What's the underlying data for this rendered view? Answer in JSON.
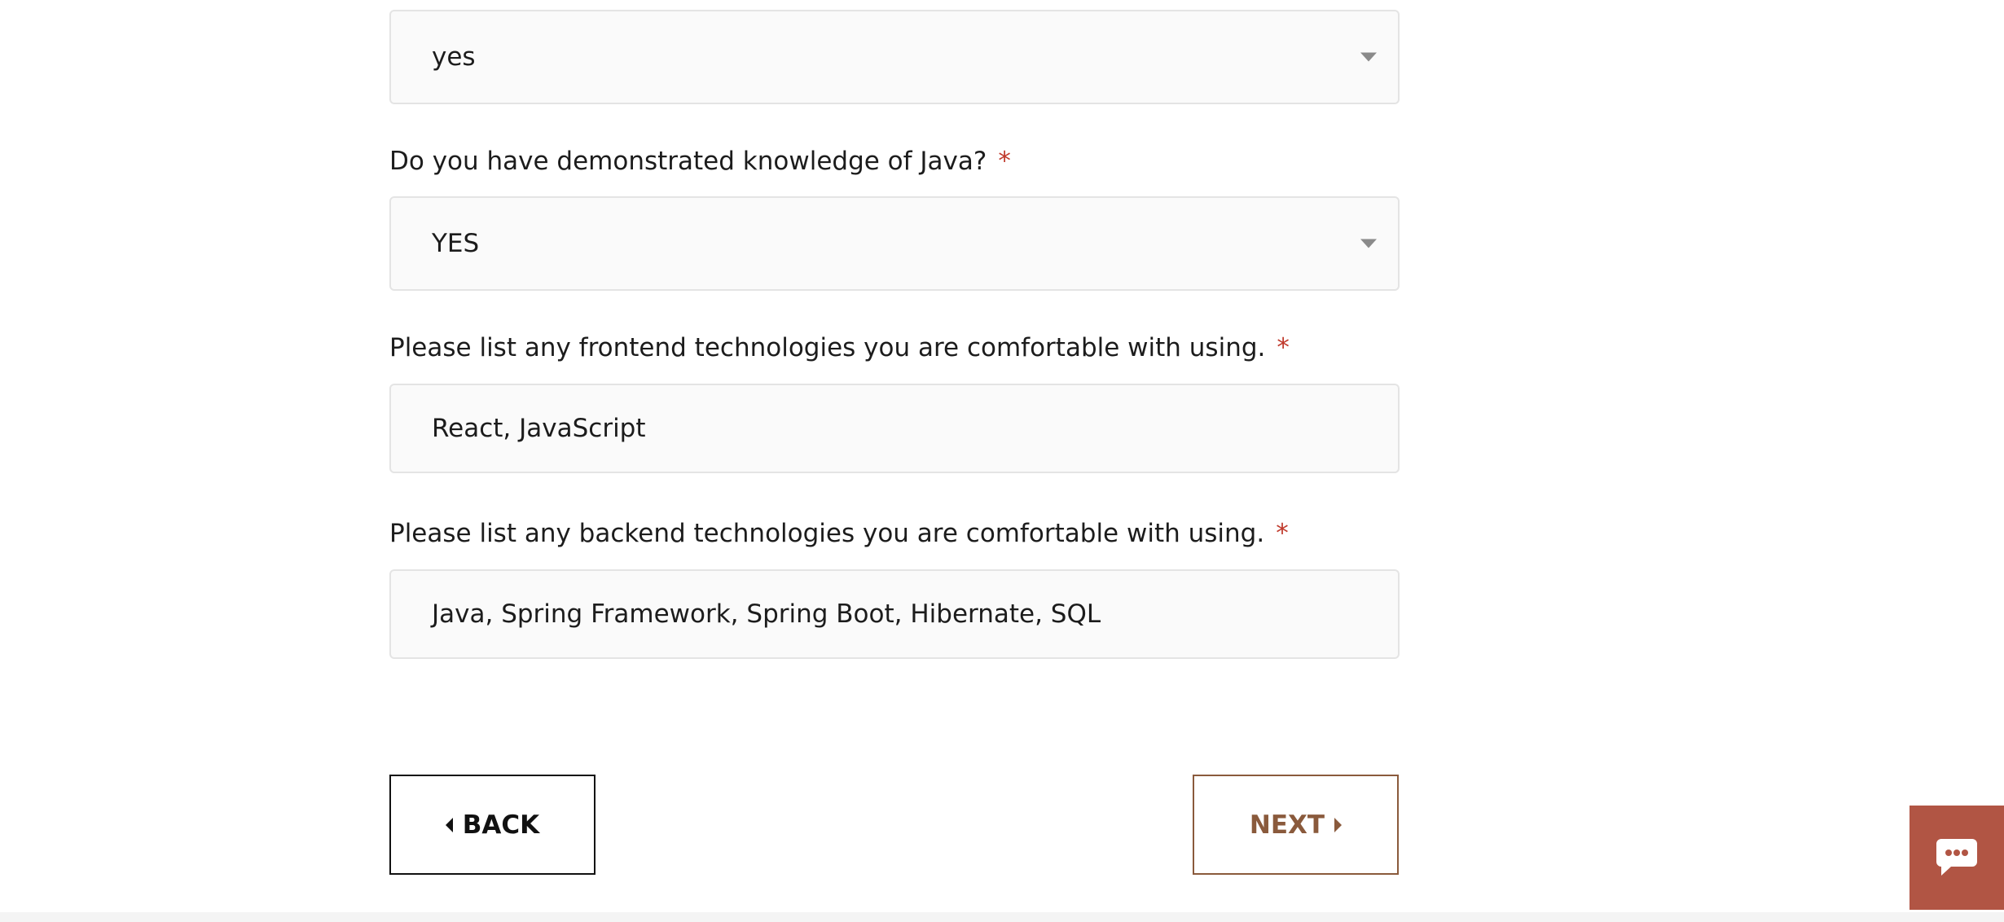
{
  "form": {
    "q_prev": {
      "value": "yes"
    },
    "q_java": {
      "label": "Do you have demonstrated knowledge of Java?",
      "required_mark": "*",
      "value": "YES"
    },
    "q_frontend": {
      "label": "Please list any frontend technologies you are comfortable with using.",
      "required_mark": "*",
      "value": "React, JavaScript"
    },
    "q_backend": {
      "label": "Please list any backend technologies you are comfortable with using.",
      "required_mark": "*",
      "value": "Java, Spring Framework, Spring Boot, Hibernate, SQL"
    }
  },
  "nav": {
    "back_label": "BACK",
    "next_label": "NEXT"
  },
  "icons": {
    "select_caret": "chevron-down-icon",
    "back": "triangle-left-icon",
    "next": "triangle-right-icon",
    "chat": "chat-bubble-icon"
  },
  "colors": {
    "required": "#c0392b",
    "next_accent": "#8a5a3c",
    "chat_widget": "#b15544"
  }
}
